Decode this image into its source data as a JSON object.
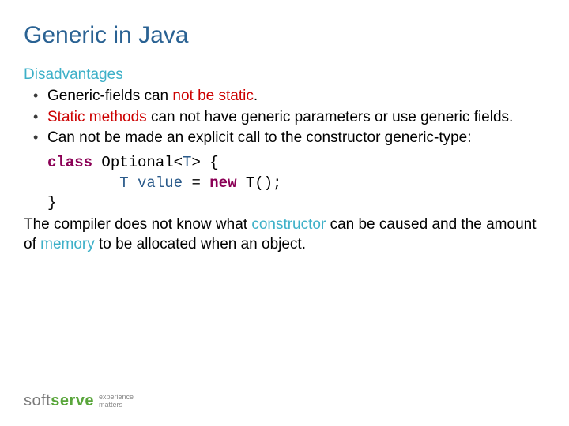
{
  "title": "Generic in Java",
  "section": "Disadvantages",
  "bullet1_pre": "Generic-fields can ",
  "bullet1_red": "not be static",
  "bullet1_post": ".",
  "bullet2_red": "Static methods",
  "bullet2_post": " can not have generic parameters or use generic fields.",
  "bullet3": "Can not be made an explicit call to the constructor generic-type:",
  "code": {
    "kw_class": "class",
    "classname": " Optional<",
    "t1": "T",
    "gt": "> {",
    "indent": "        ",
    "t2": "T",
    "value": " value",
    "eq": " = ",
    "kw_new": "new",
    "t3": " T",
    "paren": "();",
    "close": "}"
  },
  "para_pre": "The compiler does not know what ",
  "para_ctor": "constructor",
  "para_mid": " can be caused and the amount of ",
  "para_mem": "memory",
  "para_post": " to be allocated when an object.",
  "logo": {
    "soft": "soft",
    "serve": "serve",
    "tag1": "experience",
    "tag2": "matters"
  }
}
